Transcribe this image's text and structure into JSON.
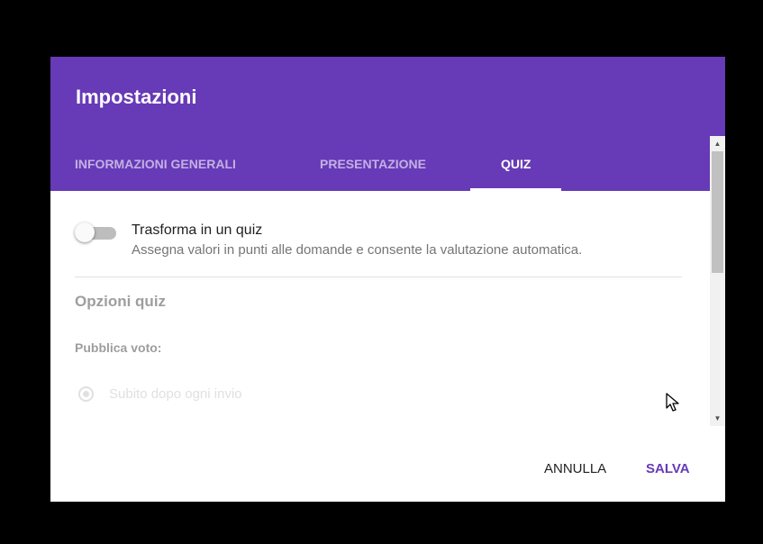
{
  "dialog": {
    "title": "Impostazioni",
    "accent_color": "#673ab7",
    "tabs": [
      {
        "label": "INFORMAZIONI GENERALI",
        "active": false
      },
      {
        "label": "PRESENTAZIONE",
        "active": false
      },
      {
        "label": "QUIZ",
        "active": true
      }
    ],
    "quiz_toggle": {
      "title": "Trasforma in un quiz",
      "description": "Assegna valori in punti alle domande e consente la valutazione automatica.",
      "checked": false
    },
    "quiz_options": {
      "section_title": "Opzioni quiz",
      "release_label": "Pubblica voto:",
      "radio_option": "Subito dopo ogni invio",
      "radio_selected": true,
      "disabled": true
    },
    "actions": {
      "cancel_label": "ANNULLA",
      "save_label": "SALVA"
    }
  },
  "icons": {
    "scroll_up": "triangle-up-icon",
    "scroll_down": "triangle-down-icon",
    "cursor": "mouse-pointer-icon"
  }
}
